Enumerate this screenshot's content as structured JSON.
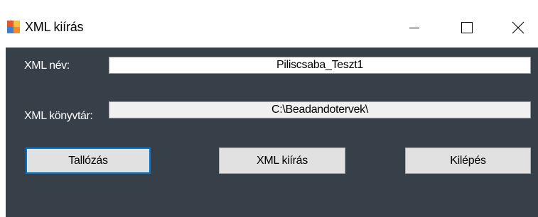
{
  "window": {
    "title": "XML kiírás",
    "icon": "app-window-icon",
    "controls": {
      "minimize_icon": "minimize-icon",
      "maximize_icon": "maximize-icon",
      "close_icon": "close-icon"
    }
  },
  "form": {
    "name_label": "XML név:",
    "name_value": "Piliscsaba_Teszt1",
    "dir_label": "XML könyvtár:",
    "dir_value": "C:\\Beadandotervek\\"
  },
  "buttons": {
    "browse_label": "Tallózás",
    "write_label": "XML kiírás",
    "exit_label": "Kilépés"
  },
  "colors": {
    "client_background": "#373f48",
    "focus_border": "#0078d7",
    "button_face": "#e1e1e1"
  }
}
